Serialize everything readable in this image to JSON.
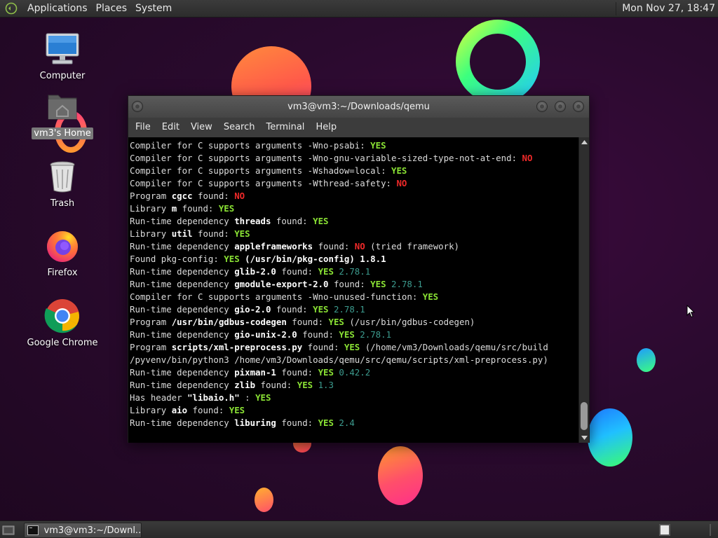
{
  "top_panel": {
    "menus": [
      "Applications",
      "Places",
      "System"
    ],
    "clock": "Mon Nov 27, 18:47"
  },
  "desktop": {
    "icons": [
      {
        "label": "Computer",
        "icon": "computer-icon"
      },
      {
        "label": "vm3's Home",
        "icon": "home-folder-icon",
        "selected": true
      },
      {
        "label": "Trash",
        "icon": "trash-icon"
      },
      {
        "label": "Firefox",
        "icon": "firefox-icon"
      },
      {
        "label": "Google Chrome",
        "icon": "chrome-icon"
      }
    ]
  },
  "terminal": {
    "title": "vm3@vm3:~/Downloads/qemu",
    "menu": [
      "File",
      "Edit",
      "View",
      "Search",
      "Terminal",
      "Help"
    ],
    "lines": [
      [
        {
          "t": "Compiler for C supports arguments -Wno-psabi: "
        },
        {
          "t": "YES",
          "c": "yes"
        }
      ],
      [
        {
          "t": "Compiler for C supports arguments -Wno-gnu-variable-sized-type-not-at-end: "
        },
        {
          "t": "NO",
          "c": "no"
        }
      ],
      [
        {
          "t": "Compiler for C supports arguments -Wshadow=local: "
        },
        {
          "t": "YES",
          "c": "yes"
        }
      ],
      [
        {
          "t": "Compiler for C supports arguments -Wthread-safety: "
        },
        {
          "t": "NO",
          "c": "no"
        }
      ],
      [
        {
          "t": "Program "
        },
        {
          "t": "cgcc",
          "c": "b"
        },
        {
          "t": " found: "
        },
        {
          "t": "NO",
          "c": "no"
        }
      ],
      [
        {
          "t": "Library "
        },
        {
          "t": "m",
          "c": "b"
        },
        {
          "t": " found: "
        },
        {
          "t": "YES",
          "c": "yes"
        }
      ],
      [
        {
          "t": "Run-time dependency "
        },
        {
          "t": "threads",
          "c": "b"
        },
        {
          "t": " found: "
        },
        {
          "t": "YES",
          "c": "yes"
        }
      ],
      [
        {
          "t": "Library "
        },
        {
          "t": "util",
          "c": "b"
        },
        {
          "t": " found: "
        },
        {
          "t": "YES",
          "c": "yes"
        }
      ],
      [
        {
          "t": "Run-time dependency "
        },
        {
          "t": "appleframeworks",
          "c": "b"
        },
        {
          "t": " found: "
        },
        {
          "t": "NO",
          "c": "no"
        },
        {
          "t": " (tried framework)"
        }
      ],
      [
        {
          "t": "Found pkg-config: "
        },
        {
          "t": "YES",
          "c": "yes"
        },
        {
          "t": " (/usr/bin/pkg-config)",
          "c": "b"
        },
        {
          "t": " 1.8.1",
          "c": "b"
        }
      ],
      [
        {
          "t": "Run-time dependency "
        },
        {
          "t": "glib-2.0",
          "c": "b"
        },
        {
          "t": " found: "
        },
        {
          "t": "YES",
          "c": "yes"
        },
        {
          "t": " 2.78.1",
          "c": "ver"
        }
      ],
      [
        {
          "t": "Run-time dependency "
        },
        {
          "t": "gmodule-export-2.0",
          "c": "b"
        },
        {
          "t": " found: "
        },
        {
          "t": "YES",
          "c": "yes"
        },
        {
          "t": " 2.78.1",
          "c": "ver"
        }
      ],
      [
        {
          "t": "Compiler for C supports arguments -Wno-unused-function: "
        },
        {
          "t": "YES",
          "c": "yes"
        }
      ],
      [
        {
          "t": "Run-time dependency "
        },
        {
          "t": "gio-2.0",
          "c": "b"
        },
        {
          "t": " found: "
        },
        {
          "t": "YES",
          "c": "yes"
        },
        {
          "t": " 2.78.1",
          "c": "ver"
        }
      ],
      [
        {
          "t": "Program "
        },
        {
          "t": "/usr/bin/gdbus-codegen",
          "c": "b"
        },
        {
          "t": " found: "
        },
        {
          "t": "YES",
          "c": "yes"
        },
        {
          "t": " (/usr/bin/gdbus-codegen)"
        }
      ],
      [
        {
          "t": "Run-time dependency "
        },
        {
          "t": "gio-unix-2.0",
          "c": "b"
        },
        {
          "t": " found: "
        },
        {
          "t": "YES",
          "c": "yes"
        },
        {
          "t": " 2.78.1",
          "c": "ver"
        }
      ],
      [
        {
          "t": "Program "
        },
        {
          "t": "scripts/xml-preprocess.py",
          "c": "b"
        },
        {
          "t": " found: "
        },
        {
          "t": "YES",
          "c": "yes"
        },
        {
          "t": " (/home/vm3/Downloads/qemu/src/build"
        }
      ],
      [
        {
          "t": "/pyvenv/bin/python3 /home/vm3/Downloads/qemu/src/qemu/scripts/xml-preprocess.py)"
        }
      ],
      [
        {
          "t": "Run-time dependency "
        },
        {
          "t": "pixman-1",
          "c": "b"
        },
        {
          "t": " found: "
        },
        {
          "t": "YES",
          "c": "yes"
        },
        {
          "t": " 0.42.2",
          "c": "ver"
        }
      ],
      [
        {
          "t": "Run-time dependency "
        },
        {
          "t": "zlib",
          "c": "b"
        },
        {
          "t": " found: "
        },
        {
          "t": "YES",
          "c": "yes"
        },
        {
          "t": " 1.3",
          "c": "ver"
        }
      ],
      [
        {
          "t": "Has header "
        },
        {
          "t": "\"libaio.h\"",
          "c": "b"
        },
        {
          "t": " : "
        },
        {
          "t": "YES",
          "c": "yes"
        }
      ],
      [
        {
          "t": "Library "
        },
        {
          "t": "aio",
          "c": "b"
        },
        {
          "t": " found: "
        },
        {
          "t": "YES",
          "c": "yes"
        }
      ],
      [
        {
          "t": "Run-time dependency "
        },
        {
          "t": "liburing",
          "c": "b"
        },
        {
          "t": " found: "
        },
        {
          "t": "YES",
          "c": "yes"
        },
        {
          "t": " 2.4",
          "c": "ver"
        }
      ]
    ]
  },
  "taskbar": {
    "window_button_label": "vm3@vm3:~/Downl..."
  },
  "colors": {
    "yes": "#8ae234",
    "no": "#ef2929",
    "version": "#3c9b8e"
  }
}
